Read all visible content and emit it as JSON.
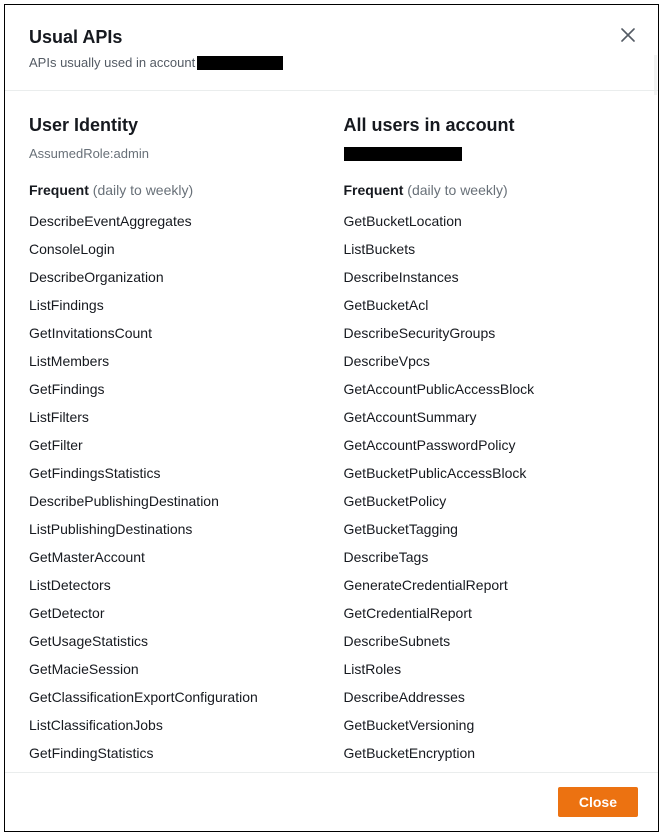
{
  "header": {
    "title": "Usual APIs",
    "subtitle_prefix": "APIs usually used in account"
  },
  "columns": {
    "left": {
      "title": "User Identity",
      "subtitle": "AssumedRole:admin",
      "frequent_label": "Frequent",
      "frequent_hint": "(daily to weekly)",
      "items": [
        "DescribeEventAggregates",
        "ConsoleLogin",
        "DescribeOrganization",
        "ListFindings",
        "GetInvitationsCount",
        "ListMembers",
        "GetFindings",
        "ListFilters",
        "GetFilter",
        "GetFindingsStatistics",
        "DescribePublishingDestination",
        "ListPublishingDestinations",
        "GetMasterAccount",
        "ListDetectors",
        "GetDetector",
        "GetUsageStatistics",
        "GetMacieSession",
        "GetClassificationExportConfiguration",
        "ListClassificationJobs",
        "GetFindingStatistics"
      ]
    },
    "right": {
      "title": "All users in account",
      "subtitle_redacted": true,
      "frequent_label": "Frequent",
      "frequent_hint": "(daily to weekly)",
      "items": [
        "GetBucketLocation",
        "ListBuckets",
        "DescribeInstances",
        "GetBucketAcl",
        "DescribeSecurityGroups",
        "DescribeVpcs",
        "GetAccountPublicAccessBlock",
        "GetAccountSummary",
        "GetAccountPasswordPolicy",
        "GetBucketPublicAccessBlock",
        "GetBucketPolicy",
        "GetBucketTagging",
        "DescribeTags",
        "GenerateCredentialReport",
        "GetCredentialReport",
        "DescribeSubnets",
        "ListRoles",
        "DescribeAddresses",
        "GetBucketVersioning",
        "GetBucketEncryption"
      ]
    }
  },
  "footer": {
    "close_label": "Close"
  },
  "icons": {
    "close_x": "close-icon"
  }
}
